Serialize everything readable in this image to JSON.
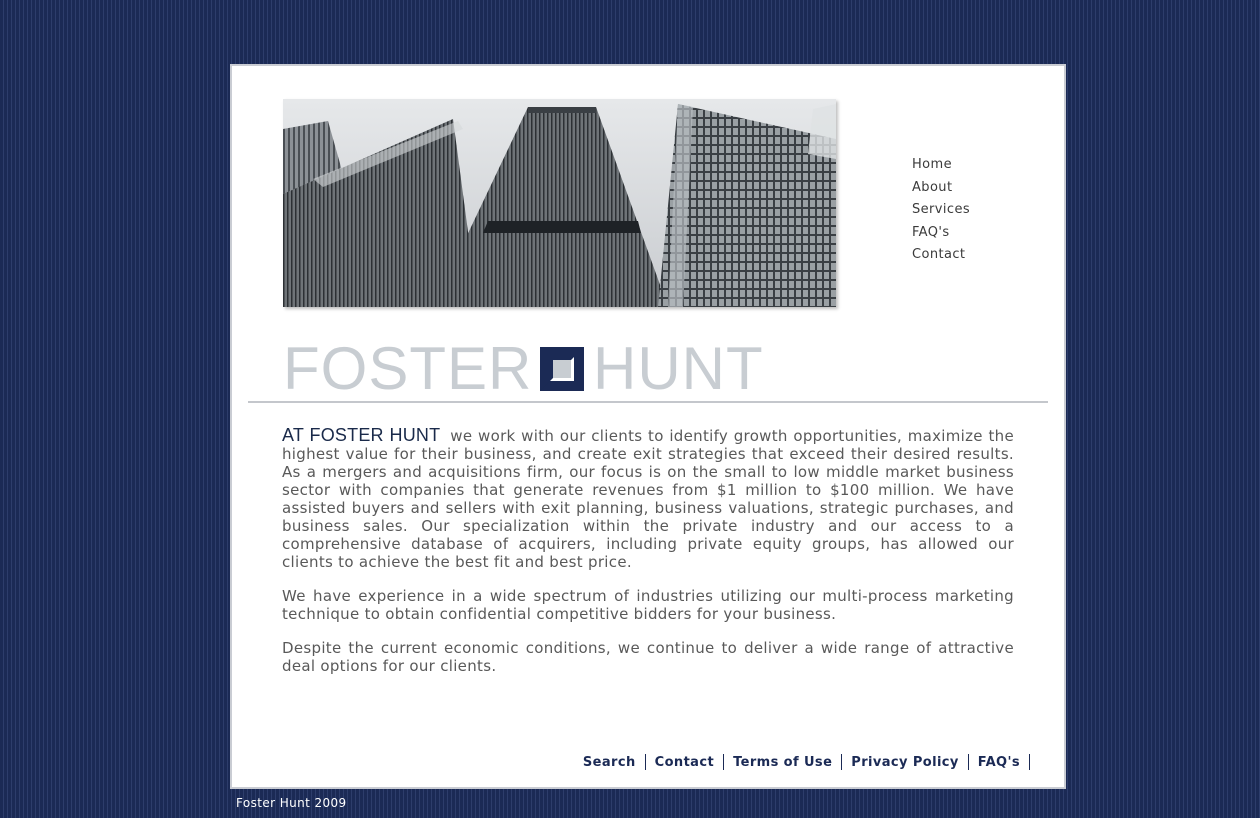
{
  "nav": {
    "items": [
      {
        "label": "Home"
      },
      {
        "label": "About"
      },
      {
        "label": "Services"
      },
      {
        "label": "FAQ's"
      },
      {
        "label": "Contact"
      }
    ]
  },
  "logo": {
    "word1": "FOSTER",
    "word2": "HUNT",
    "mark_color": "#1b2a55"
  },
  "content": {
    "lead": "AT FOSTER HUNT",
    "paragraph1": "we work with our clients to identify growth opportunities, maximize the highest value for their business, and create exit strategies that exceed their desired results. As a mergers and acquisitions firm, our focus is on the small to low middle market business sector with companies that generate revenues from $1 million to $100 million. We have assisted buyers and sellers with exit planning, business valuations, strategic purchases, and business sales. Our specialization within the private industry and our access to a comprehensive database of acquirers, including private equity groups, has allowed our clients to achieve the best fit and best price.",
    "paragraph2": "We have experience in a wide spectrum of industries utilizing our multi-process marketing technique to obtain confidential competitive bidders for your business.",
    "paragraph3": "Despite the current economic conditions, we continue to deliver a wide range of attractive deal options for our clients."
  },
  "footer": {
    "links": [
      {
        "label": "Search"
      },
      {
        "label": "Contact"
      },
      {
        "label": "Terms of Use"
      },
      {
        "label": "Privacy Policy"
      },
      {
        "label": "FAQ's"
      }
    ],
    "copyright": "Foster Hunt 2009"
  },
  "colors": {
    "background": "#1b2a55",
    "text": "#595959",
    "link": "#1b2a55"
  }
}
